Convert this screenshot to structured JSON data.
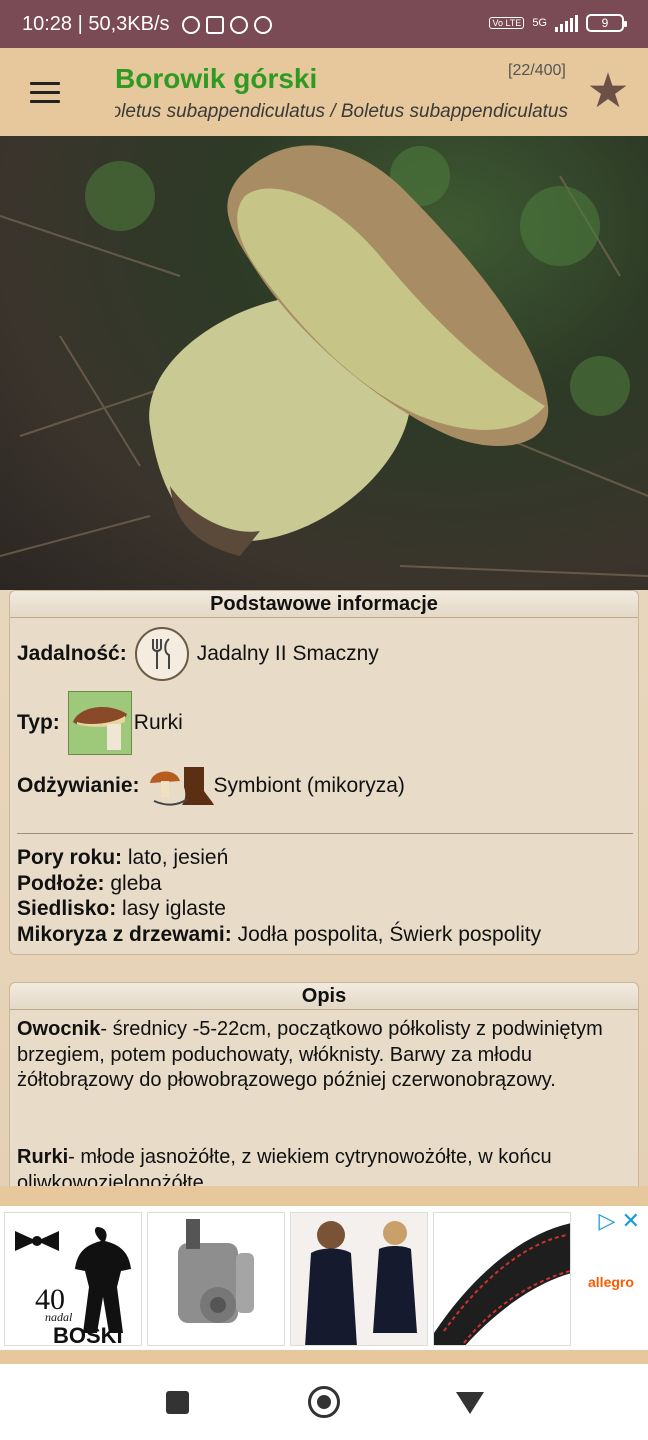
{
  "status_bar": {
    "time_speed": "10:28 | 50,3KB/s",
    "network": "5G",
    "volte": "Vo LTE",
    "battery": "9"
  },
  "app_bar": {
    "title": "Borowik górski",
    "counter": "[22/400]",
    "subtitle": "Butyriboletus subappendiculatus / Boletus subappendiculatus",
    "menu_icon": "hamburger-icon",
    "favorite_icon": "star-icon"
  },
  "basic_info": {
    "header": "Podstawowe informacje",
    "edibility_label": "Jadalność:",
    "edibility_value": "Jadalny II Smaczny",
    "type_label": "Typ:",
    "type_value": "Rurki",
    "nutrition_label": "Odżywianie:",
    "nutrition_value": "Symbiont (mikoryza)",
    "facts": [
      {
        "label": "Pory roku:",
        "value": "lato, jesień"
      },
      {
        "label": "Podłoże:",
        "value": "gleba"
      },
      {
        "label": "Siedlisko:",
        "value": "lasy iglaste"
      },
      {
        "label": "Mikoryza z drzewami:",
        "value": "Jodła pospolita, Świerk pospolity"
      }
    ]
  },
  "description": {
    "header": "Opis",
    "p1_label": "Owocnik",
    "p1_text": "- średnicy -5-22cm, początkowo półkolisty z podwiniętym brzegiem, potem poduchowaty, włóknisty. Barwy za młodu żółtobrązowy do płowobrązowego później czerwonobrązowy.",
    "p2_label": "Rurki",
    "p2_text": "- młode jasnożółte, z wiekiem cytrynowożółte, w końcu oliwkowozielonożółte"
  },
  "ad": {
    "tile1_text": "40 nadal BOSKI",
    "brand": "allegro"
  }
}
